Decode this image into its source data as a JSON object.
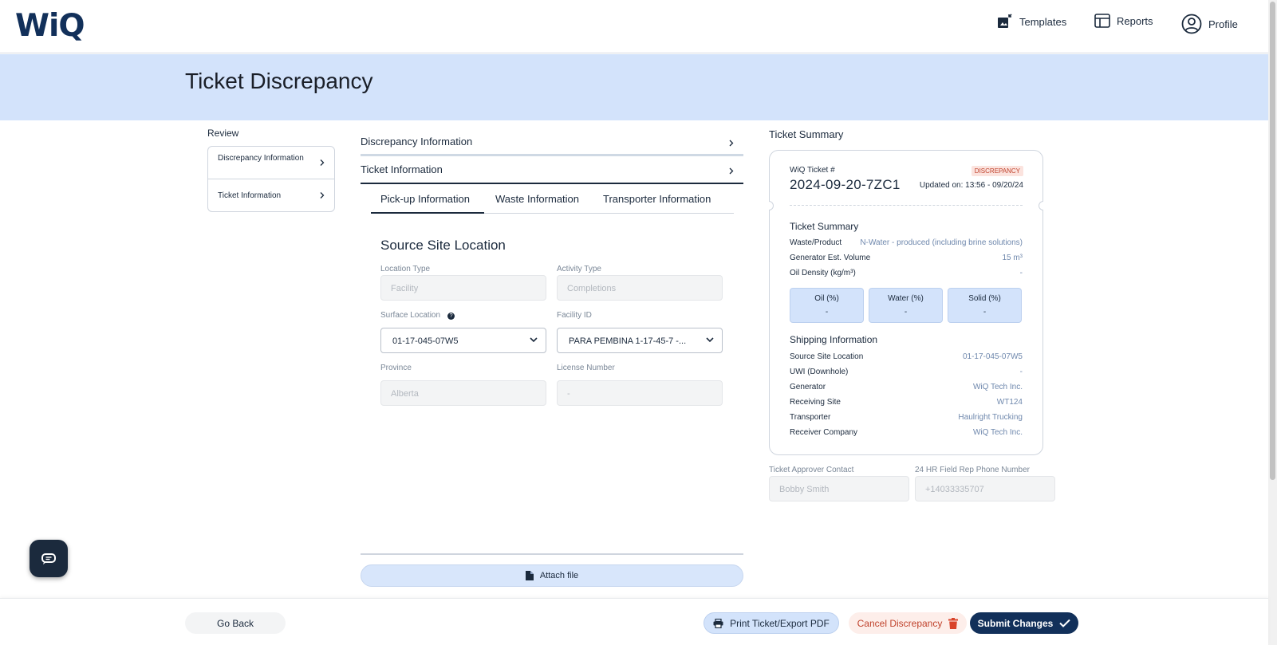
{
  "header": {
    "logo": "WiQ",
    "nav": [
      {
        "label": "Templates",
        "icon": "templates-icon"
      },
      {
        "label": "Reports",
        "icon": "reports-icon"
      },
      {
        "label": "Profile",
        "icon": "profile-icon"
      }
    ]
  },
  "page": {
    "title": "Ticket Discrepancy"
  },
  "review": {
    "label": "Review",
    "items": [
      {
        "label": "Discrepancy Information"
      },
      {
        "label": "Ticket Information"
      }
    ]
  },
  "accordions": [
    {
      "label": "Discrepancy Information"
    },
    {
      "label": "Ticket Information"
    }
  ],
  "tabs": [
    {
      "label": "Pick-up Information",
      "active": true
    },
    {
      "label": "Waste Information",
      "active": false
    },
    {
      "label": "Transporter Information",
      "active": false
    }
  ],
  "form": {
    "section_title": "Source Site Location",
    "location_type": {
      "label": "Location Type",
      "placeholder": "Facility"
    },
    "activity_type": {
      "label": "Activity Type",
      "placeholder": "Completions"
    },
    "surface_location": {
      "label": "Surface Location",
      "help": "?",
      "value": "01-17-045-07W5"
    },
    "facility_id": {
      "label": "Facility ID",
      "value": "PARA PEMBINA 1-17-45-7 -..."
    },
    "province": {
      "label": "Province",
      "placeholder": "Alberta"
    },
    "license_number": {
      "label": "License Number",
      "placeholder": "-"
    }
  },
  "attach": {
    "label": "Attach file"
  },
  "summary": {
    "heading": "Ticket Summary",
    "ticket_label": "WiQ Ticket #",
    "ticket_number": "2024-09-20-7ZC1",
    "status": "DISCREPANCY",
    "updated": "Updated on: 13:56 - 09/20/24",
    "ticket_summary_title": "Ticket Summary",
    "rows": [
      {
        "label": "Waste/Product",
        "value": "N-Water - produced (including brine solutions)"
      },
      {
        "label": "Generator Est. Volume",
        "value": "15 m³"
      },
      {
        "label": "Oil Density (kg/m³)",
        "value": "-"
      }
    ],
    "percents": [
      {
        "label": "Oil (%)",
        "value": "-"
      },
      {
        "label": "Water (%)",
        "value": "-"
      },
      {
        "label": "Solid (%)",
        "value": "-"
      }
    ],
    "shipping_title": "Shipping Information",
    "shipping": [
      {
        "label": "Source Site Location",
        "value": "01-17-045-07W5"
      },
      {
        "label": "UWI (Downhole)",
        "value": "-"
      },
      {
        "label": "Generator",
        "value": "WiQ Tech Inc."
      },
      {
        "label": "Receiving Site",
        "value": "WT124"
      },
      {
        "label": "Transporter",
        "value": "Haulright Trucking"
      },
      {
        "label": "Receiver Company",
        "value": "WiQ Tech Inc."
      }
    ]
  },
  "contacts": {
    "approver": {
      "label": "Ticket Approver Contact",
      "placeholder": "Bobby Smith"
    },
    "field_rep": {
      "label": "24 HR Field Rep Phone Number",
      "placeholder": "+14033335707"
    }
  },
  "footer": {
    "back": "Go Back",
    "print": "Print Ticket/Export PDF",
    "cancel": "Cancel Discrepancy",
    "submit": "Submit Changes"
  },
  "colors": {
    "brand": "#12305a",
    "banner": "#d3e3fb",
    "danger": "#c0432d"
  }
}
